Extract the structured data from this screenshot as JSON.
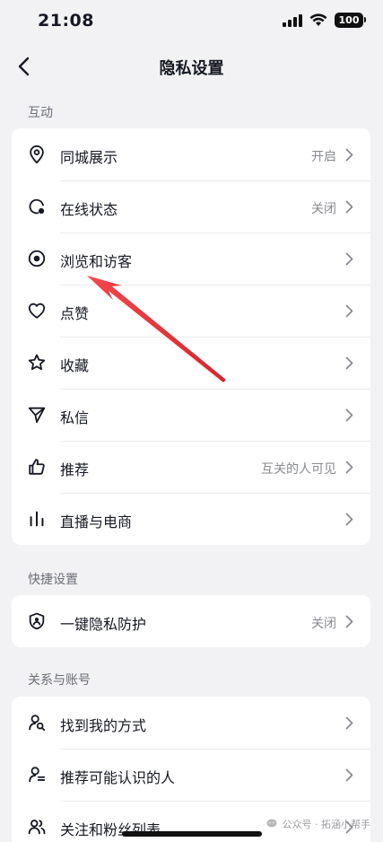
{
  "status_bar": {
    "time": "21:08",
    "battery": "100"
  },
  "nav": {
    "title": "隐私设置"
  },
  "sections": [
    {
      "header": "互动",
      "items": [
        {
          "icon": "location-pin-icon",
          "label": "同城展示",
          "value": "开启"
        },
        {
          "icon": "online-status-icon",
          "label": "在线状态",
          "value": "关闭"
        },
        {
          "icon": "eye-icon",
          "label": "浏览和访客",
          "value": ""
        },
        {
          "icon": "heart-icon",
          "label": "点赞",
          "value": ""
        },
        {
          "icon": "star-icon",
          "label": "收藏",
          "value": ""
        },
        {
          "icon": "send-icon",
          "label": "私信",
          "value": ""
        },
        {
          "icon": "thumbs-up-icon",
          "label": "推荐",
          "value": "互关的人可见"
        },
        {
          "icon": "live-bars-icon",
          "label": "直播与电商",
          "value": ""
        }
      ]
    },
    {
      "header": "快捷设置",
      "items": [
        {
          "icon": "privacy-shield-icon",
          "label": "一键隐私防护",
          "value": "关闭"
        }
      ]
    },
    {
      "header": "关系与账号",
      "items": [
        {
          "icon": "find-me-icon",
          "label": "找到我的方式",
          "value": ""
        },
        {
          "icon": "suggest-people-icon",
          "label": "推荐可能认识的人",
          "value": ""
        },
        {
          "icon": "followers-icon",
          "label": "关注和粉丝列表",
          "value": ""
        }
      ]
    }
  ],
  "watermark": {
    "text": "公众号 · 拓涵小帮手"
  },
  "colors": {
    "background": "#f2f2f4",
    "card": "#ffffff",
    "arrow": "#e8343c",
    "text": "#161823",
    "secondary": "#8a8b91"
  }
}
